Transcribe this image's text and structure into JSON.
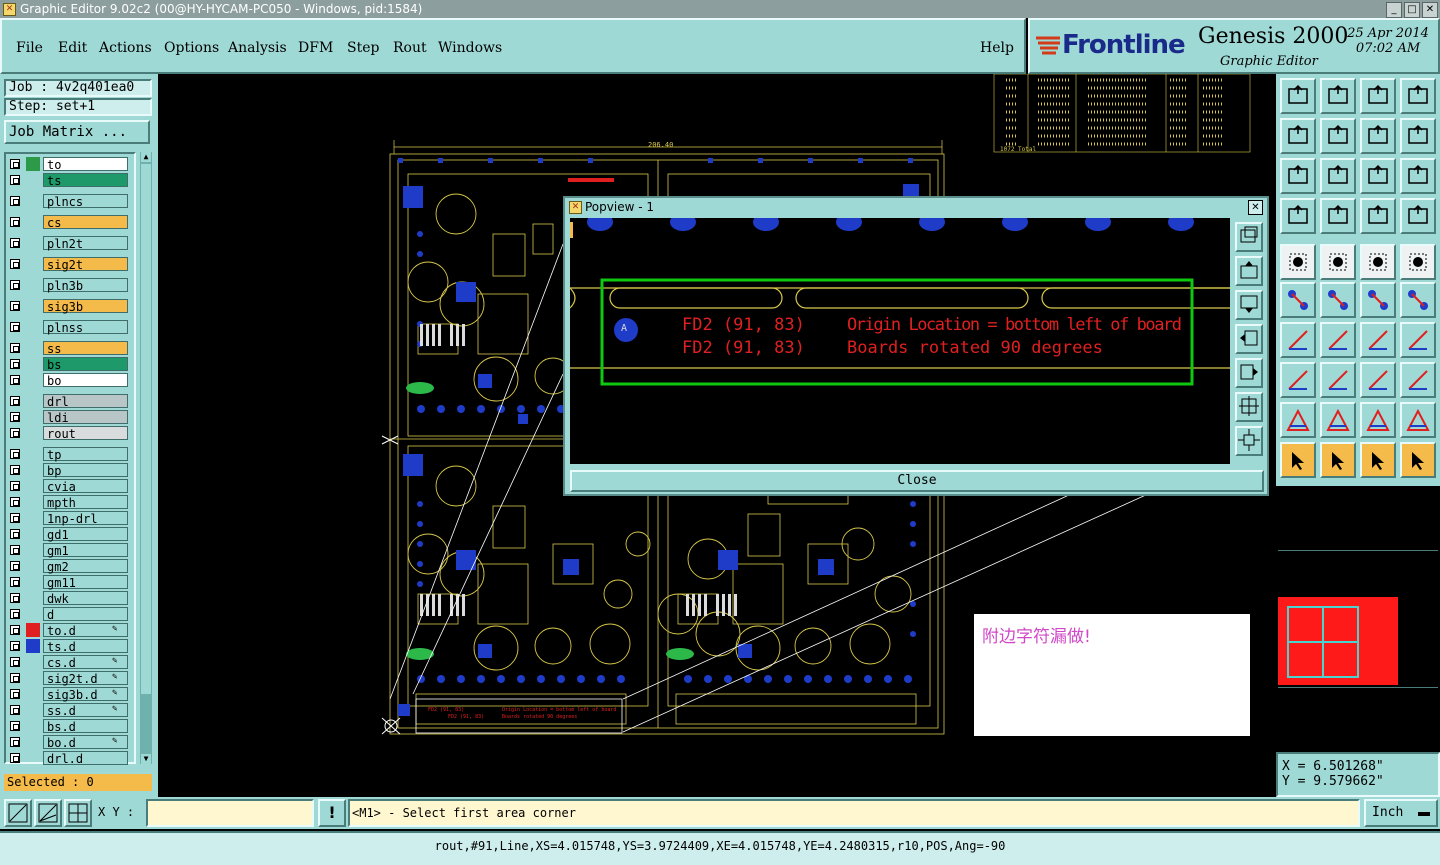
{
  "window": {
    "title": "Graphic Editor 9.02c2 (00@HY-HYCAM-PC050 - Windows, pid:1584)"
  },
  "menu": {
    "items": [
      {
        "label": "File"
      },
      {
        "label": "Edit"
      },
      {
        "label": "Actions"
      },
      {
        "label": "Options"
      },
      {
        "label": "Analysis"
      },
      {
        "label": "DFM"
      },
      {
        "label": "Step"
      },
      {
        "label": "Rout"
      },
      {
        "label": "Windows"
      }
    ],
    "help": "Help"
  },
  "brand": {
    "logo": "Frontline",
    "product": "Genesis 2000",
    "subtitle": "Graphic Editor",
    "date": "25 Apr 2014",
    "time": "07:02 AM"
  },
  "job": {
    "label": "Job : 4v2q401ea0",
    "step": "Step: set+1",
    "matrix_button": "Job Matrix ..."
  },
  "layers": [
    {
      "name": "to",
      "swatch": "#2d9a4a",
      "bg": "#ffffff",
      "group": 0
    },
    {
      "name": "ts",
      "swatch": "",
      "bg": "#1e9a6a",
      "group": 0
    },
    {
      "name": "plncs",
      "swatch": "",
      "bg": "#9fd9d5",
      "group": 1
    },
    {
      "name": "cs",
      "swatch": "",
      "bg": "#f4ba4a",
      "group": 2
    },
    {
      "name": "pln2t",
      "swatch": "",
      "bg": "#9fd9d5",
      "group": 3
    },
    {
      "name": "sig2t",
      "swatch": "",
      "bg": "#f4ba4a",
      "group": 4
    },
    {
      "name": "pln3b",
      "swatch": "",
      "bg": "#9fd9d5",
      "group": 5
    },
    {
      "name": "sig3b",
      "swatch": "",
      "bg": "#f4ba4a",
      "group": 6
    },
    {
      "name": "plnss",
      "swatch": "",
      "bg": "#9fd9d5",
      "group": 7
    },
    {
      "name": "ss",
      "swatch": "",
      "bg": "#f4ba4a",
      "group": 8
    },
    {
      "name": "bs",
      "swatch": "",
      "bg": "#1e9a6a",
      "group": 8
    },
    {
      "name": "bo",
      "swatch": "",
      "bg": "#ffffff",
      "group": 8
    },
    {
      "name": "drl",
      "swatch": "",
      "bg": "#b8c6c8",
      "group": 9
    },
    {
      "name": "ldi",
      "swatch": "",
      "bg": "#b8c6c8",
      "group": 9
    },
    {
      "name": "rout",
      "swatch": "",
      "bg": "#d8dcdc",
      "group": 9
    },
    {
      "name": "tp",
      "swatch": "",
      "bg": "#9fd9d5",
      "group": 10
    },
    {
      "name": "bp",
      "swatch": "",
      "bg": "#9fd9d5",
      "group": 10
    },
    {
      "name": "cvia",
      "swatch": "",
      "bg": "#9fd9d5",
      "group": 10
    },
    {
      "name": "mpth",
      "swatch": "",
      "bg": "#9fd9d5",
      "group": 10
    },
    {
      "name": "1np-drl",
      "swatch": "",
      "bg": "#9fd9d5",
      "group": 10
    },
    {
      "name": "gd1",
      "swatch": "",
      "bg": "#9fd9d5",
      "group": 10
    },
    {
      "name": "gm1",
      "swatch": "",
      "bg": "#9fd9d5",
      "group": 10
    },
    {
      "name": "gm2",
      "swatch": "",
      "bg": "#9fd9d5",
      "group": 10
    },
    {
      "name": "gm11",
      "swatch": "",
      "bg": "#9fd9d5",
      "group": 10
    },
    {
      "name": "dwk",
      "swatch": "",
      "bg": "#9fd9d5",
      "group": 10
    },
    {
      "name": "d",
      "swatch": "",
      "bg": "#9fd9d5",
      "group": 10
    },
    {
      "name": "to.d",
      "swatch": "#e02020",
      "bg": "#9fd9d5",
      "group": 10,
      "pen": true
    },
    {
      "name": "ts.d",
      "swatch": "#1e3cc8",
      "bg": "#9fd9d5",
      "group": 10
    },
    {
      "name": "cs.d",
      "swatch": "",
      "bg": "#9fd9d5",
      "group": 10,
      "pen": true
    },
    {
      "name": "sig2t.d",
      "swatch": "",
      "bg": "#9fd9d5",
      "group": 10,
      "pen": true
    },
    {
      "name": "sig3b.d",
      "swatch": "",
      "bg": "#9fd9d5",
      "group": 10,
      "pen": true
    },
    {
      "name": "ss.d",
      "swatch": "",
      "bg": "#9fd9d5",
      "group": 10,
      "pen": true
    },
    {
      "name": "bs.d",
      "swatch": "",
      "bg": "#9fd9d5",
      "group": 10
    },
    {
      "name": "bo.d",
      "swatch": "",
      "bg": "#9fd9d5",
      "group": 10,
      "pen": true
    },
    {
      "name": "drl.d",
      "swatch": "",
      "bg": "#9fd9d5",
      "group": 10
    }
  ],
  "selected": "Selected : 0",
  "popview": {
    "title": "Popview - 1",
    "pad_letter": "A",
    "line1_left": "FD2 (91, 83)",
    "line1_right": "Origin Location = bottom left of board",
    "line2_left": "FD2 (91, 83)",
    "line2_right": "Boards rotated 90 degrees",
    "close": "Close"
  },
  "canvas": {
    "dimension": "206.40",
    "note": "附边字符漏做!",
    "small_line1_left": "FD2 (91, 83)",
    "small_line1_right": "Origin Location = bottom left of board",
    "small_line2_left": "FD2 (91, 83)",
    "small_line2_right": "Boards rotated 90 degrees",
    "table_last": "1072 Total"
  },
  "coords": {
    "x": "X  =  6.501268\"",
    "y": "Y  =  9.579662\""
  },
  "bottom": {
    "xy_label": "X Y :",
    "xy_value": "",
    "prompt": "<M1> - Select first area corner",
    "units": "Inch"
  },
  "status": "rout,#91,Line,XS=4.015748,YS=3.9724409,XE=4.015748,YE=4.2480315,r10,POS,Ang=-90",
  "colors": {
    "panel": "#9fd9d5",
    "accent_orange": "#f4ba4a",
    "cad_red": "#e02020",
    "cad_yellow": "#d8c84a",
    "cad_blue": "#1e3cc8",
    "frame_green": "#10c810"
  }
}
